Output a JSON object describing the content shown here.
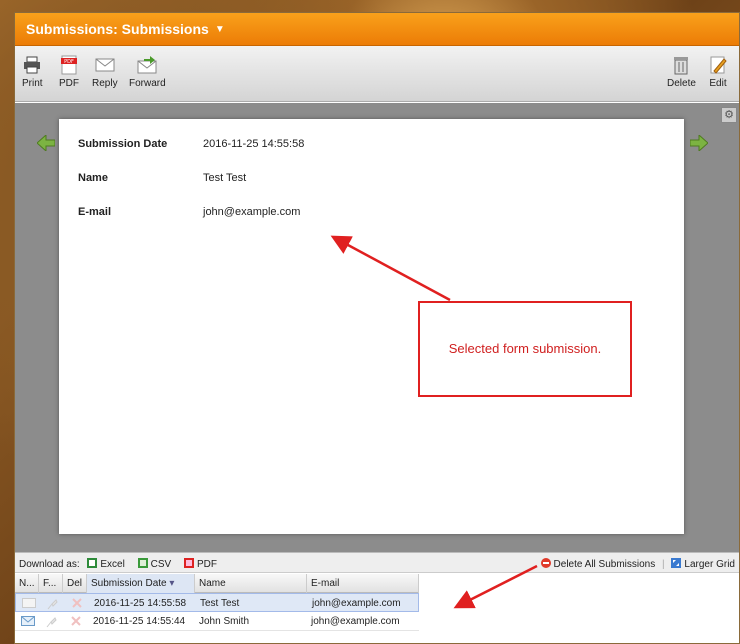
{
  "window": {
    "title": "Submissions: Submissions",
    "title_caret": "▼"
  },
  "toolbar": {
    "print": "Print",
    "pdf": "PDF",
    "reply": "Reply",
    "forward": "Forward",
    "delete": "Delete",
    "edit": "Edit"
  },
  "submission": {
    "fields": [
      {
        "label": "Submission Date",
        "value": "2016-11-25 14:55:58"
      },
      {
        "label": "Name",
        "value": "Test Test"
      },
      {
        "label": "E-mail",
        "value": "john@example.com"
      }
    ]
  },
  "callout": {
    "text": "Selected form submission."
  },
  "bottombar": {
    "download_as": "Download as:",
    "excel": "Excel",
    "csv": "CSV",
    "pdf": "PDF",
    "delete_all": "Delete All Submissions",
    "larger_grid": "Larger Grid"
  },
  "grid": {
    "columns": [
      "N...",
      "F...",
      "Del",
      "Submission Date",
      "Name",
      "E-mail"
    ],
    "rows": [
      {
        "date": "2016-11-25 14:55:58",
        "name": "Test Test",
        "email": "john@example.com",
        "selected": true
      },
      {
        "date": "2016-11-25 14:55:44",
        "name": "John Smith",
        "email": "john@example.com",
        "selected": false
      }
    ]
  },
  "colors": {
    "title_orange": "#f39015",
    "callout_red": "#e02020",
    "selection_blue": "#dfe8f6"
  }
}
